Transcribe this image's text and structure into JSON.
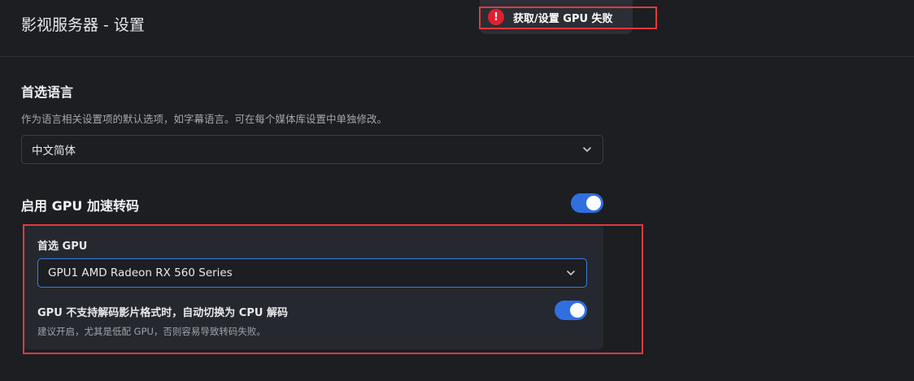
{
  "header": {
    "title": "影视服务器 - 设置"
  },
  "toast": {
    "icon": "error-icon",
    "icon_glyph": "!",
    "message": "获取/设置 GPU 失败",
    "color": "#e01f2e"
  },
  "language": {
    "title": "首选语言",
    "description": "作为语言相关设置项的默认选项，如字幕语言。可在每个媒体库设置中单独修改。",
    "selected": "中文简体"
  },
  "gpu": {
    "title": "启用 GPU 加速转码",
    "enabled": true,
    "preferred_label": "首选 GPU",
    "preferred_selected": "GPU1 AMD Radeon RX 560 Series",
    "fallback_label": "GPU 不支持解码影片格式时，自动切换为 CPU 解码",
    "fallback_enabled": true,
    "fallback_desc": "建议开启，尤其是低配 GPU，否则容易导致转码失败。"
  },
  "colors": {
    "accent": "#2f6fe0",
    "error": "#e0393f",
    "background": "#1c1e22"
  }
}
